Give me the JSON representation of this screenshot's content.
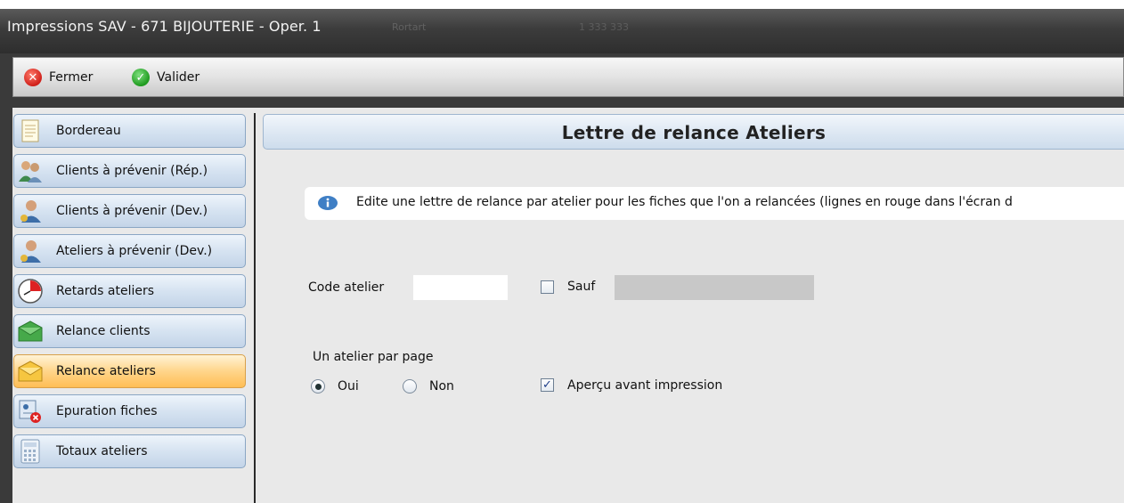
{
  "window": {
    "title": "Impressions SAV - 671 BIJOUTERIE - Oper. 1",
    "ghost_text_1": "Rortart",
    "ghost_text_2": "1 333 333"
  },
  "toolbar": {
    "close_label": "Fermer",
    "close_icon": "close-icon",
    "validate_label": "Valider",
    "validate_icon": "check-icon"
  },
  "sidebar": {
    "items": [
      {
        "label": "Bordereau",
        "icon": "document-icon",
        "active": false
      },
      {
        "label": "Clients à prévenir (Rép.)",
        "icon": "users-icon",
        "active": false
      },
      {
        "label": "Clients à prévenir (Dev.)",
        "icon": "user-icon",
        "active": false
      },
      {
        "label": "Ateliers à prévenir (Dev.)",
        "icon": "user-icon",
        "active": false
      },
      {
        "label": "Retards ateliers",
        "icon": "clock-icon",
        "active": false
      },
      {
        "label": "Relance clients",
        "icon": "envelope-green-icon",
        "active": false
      },
      {
        "label": "Relance ateliers",
        "icon": "envelope-yellow-icon",
        "active": true
      },
      {
        "label": "Epuration fiches",
        "icon": "delete-card-icon",
        "active": false
      },
      {
        "label": "Totaux ateliers",
        "icon": "calculator-icon",
        "active": false
      }
    ]
  },
  "main": {
    "title": "Lettre de relance Ateliers",
    "info_text": "Edite une lettre de relance par atelier pour les fiches que l'on a relancées (lignes en rouge dans l'écran d",
    "code_atelier_label": "Code atelier",
    "code_atelier_value": "",
    "sauf_label": "Sauf",
    "sauf_checked": false,
    "sauf_value": "",
    "per_page_label": "Un atelier par page",
    "oui_label": "Oui",
    "non_label": "Non",
    "per_page_selected": "Oui",
    "preview_label": "Aperçu avant impression",
    "preview_checked": true
  },
  "colors": {
    "active_item": "#ffbe55",
    "nav_blue": "#c3d4e8",
    "titlebar": "#3c3c3c"
  }
}
